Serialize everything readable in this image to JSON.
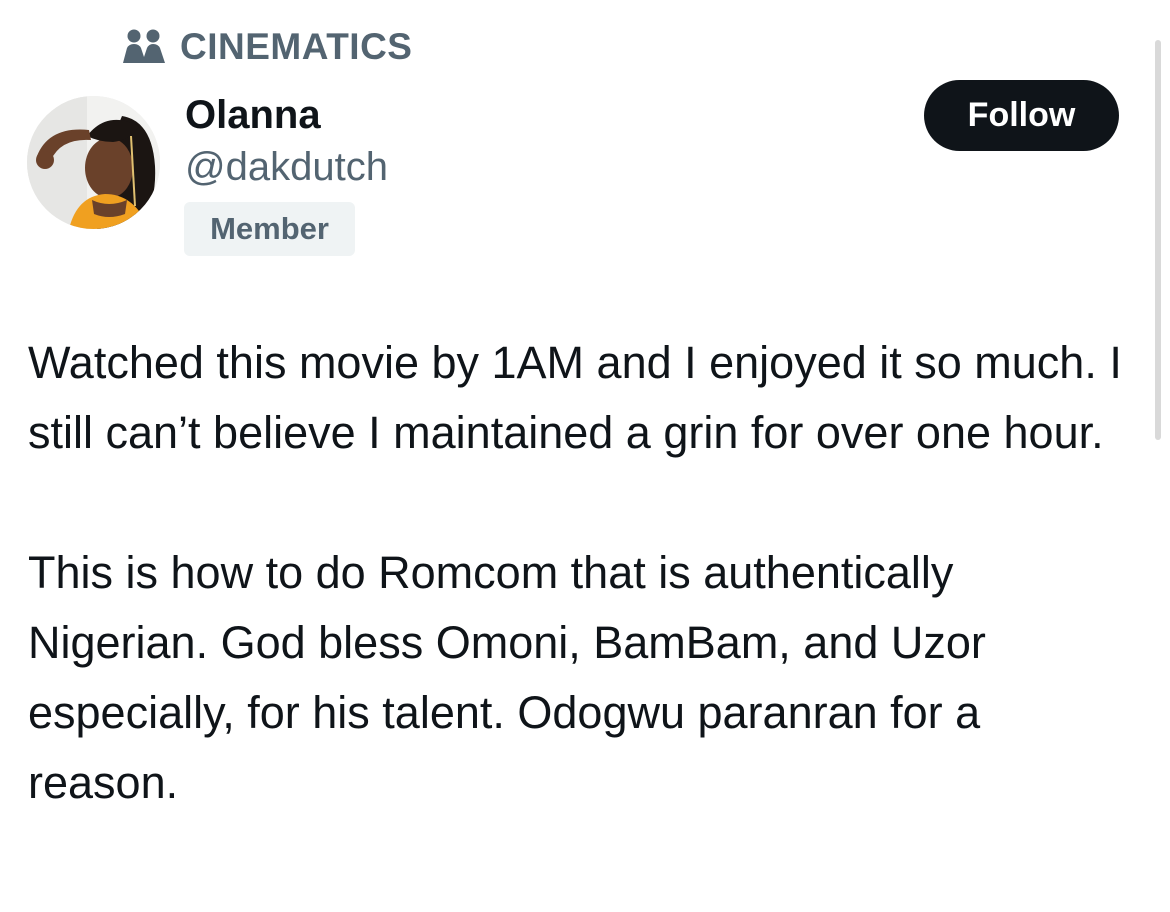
{
  "community": {
    "icon": "community-people-icon",
    "label": "CINEMATICS"
  },
  "author": {
    "avatar": "profile-photo",
    "display_name": "Olanna",
    "handle": "@dakdutch",
    "badge": "Member"
  },
  "actions": {
    "follow_label": "Follow"
  },
  "tweet": {
    "paragraphs": [
      "Watched this movie by 1AM and I enjoyed it so much. I still can’t believe I maintained a grin for over one hour.",
      "This is how to do Romcom that is authentically Nigerian. God bless Omoni, BamBam, and Uzor especially, for his talent. Odogwu paranran for a reason."
    ]
  },
  "colors": {
    "text_primary": "#0f1419",
    "text_secondary": "#536471",
    "button_bg": "#0f1419",
    "badge_bg": "#eff3f4"
  }
}
